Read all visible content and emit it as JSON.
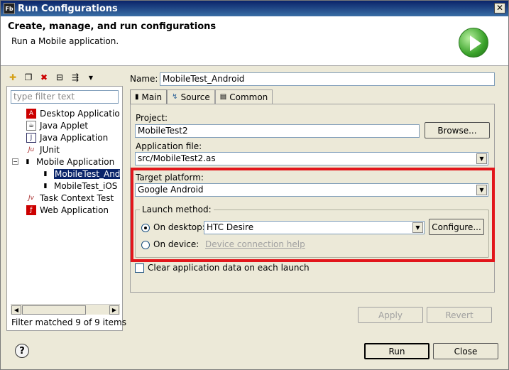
{
  "window": {
    "title": "Run Configurations",
    "app_icon": "Fb"
  },
  "header": {
    "title": "Create, manage, and run configurations",
    "subtitle": "Run a Mobile application."
  },
  "sidebar": {
    "filter_placeholder": "type filter text",
    "items": [
      {
        "label": "Desktop Application",
        "icon": "air-icon"
      },
      {
        "label": "Java Applet",
        "icon": "applet-icon"
      },
      {
        "label": "Java Application",
        "icon": "java-icon"
      },
      {
        "label": "JUnit",
        "icon": "junit-icon",
        "icon_text": "Ju"
      },
      {
        "label": "Mobile Application",
        "icon": "mobile-icon"
      },
      {
        "label": "MobileTest_Android",
        "icon": "mobile-icon"
      },
      {
        "label": "MobileTest_iOS",
        "icon": "mobile-icon"
      },
      {
        "label": "Task Context Test",
        "icon": "task-icon",
        "icon_text": "Jv"
      },
      {
        "label": "Web Application",
        "icon": "flash-icon"
      }
    ],
    "filter_status": "Filter matched 9 of 9 items"
  },
  "form": {
    "name_label": "Name:",
    "name_value": "MobileTest_Android",
    "tabs": [
      {
        "label": "Main"
      },
      {
        "label": "Source"
      },
      {
        "label": "Common"
      }
    ],
    "project_label": "Project:",
    "project_value": "MobileTest2",
    "browse_label": "Browse...",
    "app_file_label": "Application file:",
    "app_file_value": "src/MobileTest2.as",
    "target_label": "Target platform:",
    "target_value": "Google Android",
    "launch_label": "Launch method:",
    "desktop_label": "On desktop:",
    "desktop_value": "HTC Desire",
    "configure_label": "Configure...",
    "device_label": "On device:",
    "device_help": "Device connection help",
    "clear_label": "Clear application data on each launch",
    "apply_label": "Apply",
    "revert_label": "Revert"
  },
  "footer": {
    "run_label": "Run",
    "close_label": "Close"
  },
  "colors": {
    "highlight_border": "#e2161b",
    "selection": "#0a246a"
  }
}
